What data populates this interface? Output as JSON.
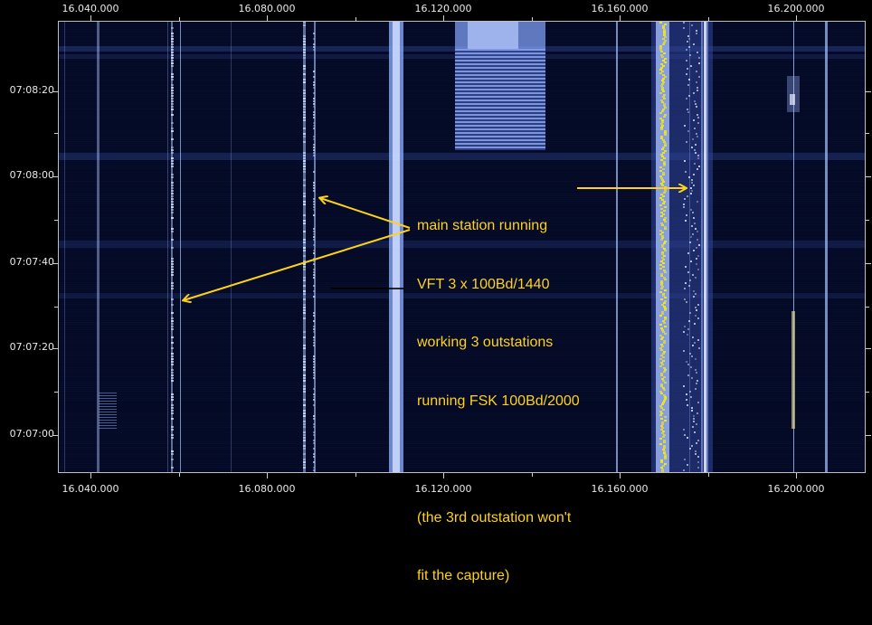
{
  "axes": {
    "x_ticks": [
      "16.040.000",
      "16.080.000",
      "16.120.000",
      "16.160.000",
      "16.200.000"
    ],
    "y_ticks": [
      "07:08:20",
      "07:08:00",
      "07:07:40",
      "07:07:20",
      "07:07:00"
    ]
  },
  "annotation": {
    "lines": [
      "main station running",
      "VFT 3 x 100Bd/1440",
      "working 3 outstations",
      "running FSK 100Bd/2000",
      "",
      "(the 3rd outstation won't",
      "fit the capture)"
    ],
    "color": "#ffd21a"
  },
  "colors": {
    "background": "#040924",
    "signal": "#a8c4ff",
    "marker": "#f2e81a"
  }
}
